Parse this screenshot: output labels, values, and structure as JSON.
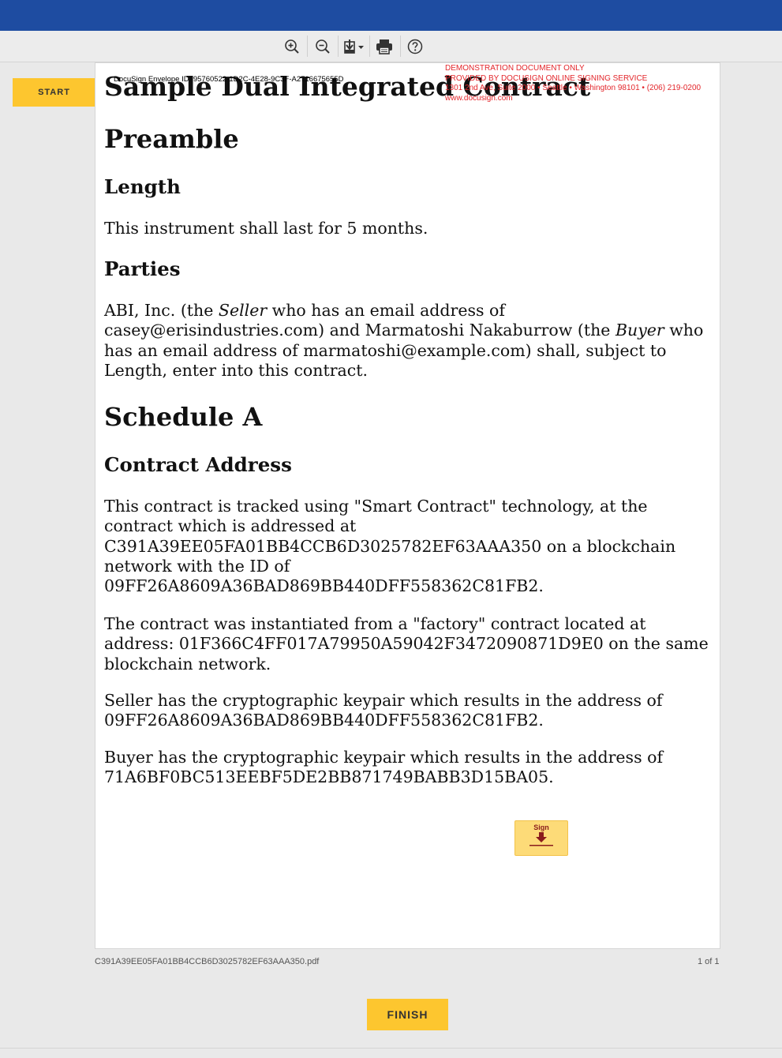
{
  "toolbar": {
    "buttons": [
      {
        "name": "zoom-in-button",
        "icon": "zoom-in-icon"
      },
      {
        "name": "zoom-out-button",
        "icon": "zoom-out-icon"
      },
      {
        "name": "download-button",
        "icon": "download-icon"
      },
      {
        "name": "print-button",
        "icon": "print-icon"
      },
      {
        "name": "help-button",
        "icon": "help-icon"
      }
    ]
  },
  "start_label": "START",
  "finish_label": "FINISH",
  "document": {
    "envelope_id": "DocuSign Envelope ID: 95760522-1D2C-4E28-9C3F-A2716675655D",
    "demo_lines": [
      "DEMONSTRATION DOCUMENT ONLY",
      "PROVIDED BY DOCUSIGN ONLINE SIGNING SERVICE",
      "1301 2nd Ave, Suite 2000 • Seattle • Washington 98101 • (206) 219-0200",
      "www.docusign.com"
    ],
    "title": "Sample Dual Integrated Contract",
    "preamble_heading": "Preamble",
    "length_heading": "Length",
    "length_text": "This instrument shall last for 5 months.",
    "parties_heading": "Parties",
    "parties_text": {
      "part1": "ABI, Inc. (the ",
      "seller": "Seller",
      "part2": " who has an email address of casey@erisindustries.com) and Marmatoshi Nakaburrow (the ",
      "buyer": "Buyer",
      "part3": " who has an email address of marmatoshi@example.com) shall, subject to Length, enter into this contract."
    },
    "schedule_heading": "Schedule A",
    "contract_address_heading": "Contract Address",
    "para1": "This contract is tracked using \"Smart Contract\" technology, at the contract which is addressed at C391A39EE05FA01BB4CCB6D3025782EF63AAA350 on a blockchain network with the ID of 09FF26A8609A36BAD869BB440DFF558362C81FB2.",
    "para2": "The contract was instantiated from a \"factory\" contract located at address: 01F366C4FF017A79950A59042F3472090871D9E0 on the same blockchain network.",
    "para3": "Seller has the cryptographic keypair which results in the address of 09FF26A8609A36BAD869BB440DFF558362C81FB2.",
    "para4": "Buyer has the cryptographic keypair which results in the address of 71A6BF0BC513EEBF5DE2BB871749BABB3D15BA05.",
    "sign_label": "Sign"
  },
  "footer": {
    "file_name": "C391A39EE05FA01BB4CCB6D3025782EF63AAA350.pdf",
    "page_count": "1 of 1"
  },
  "colors": {
    "header_blue": "#1e4ca1",
    "action_yellow": "#fdc62f",
    "demo_red": "#e3262b",
    "sign_tag_yellow": "#fddb78"
  }
}
